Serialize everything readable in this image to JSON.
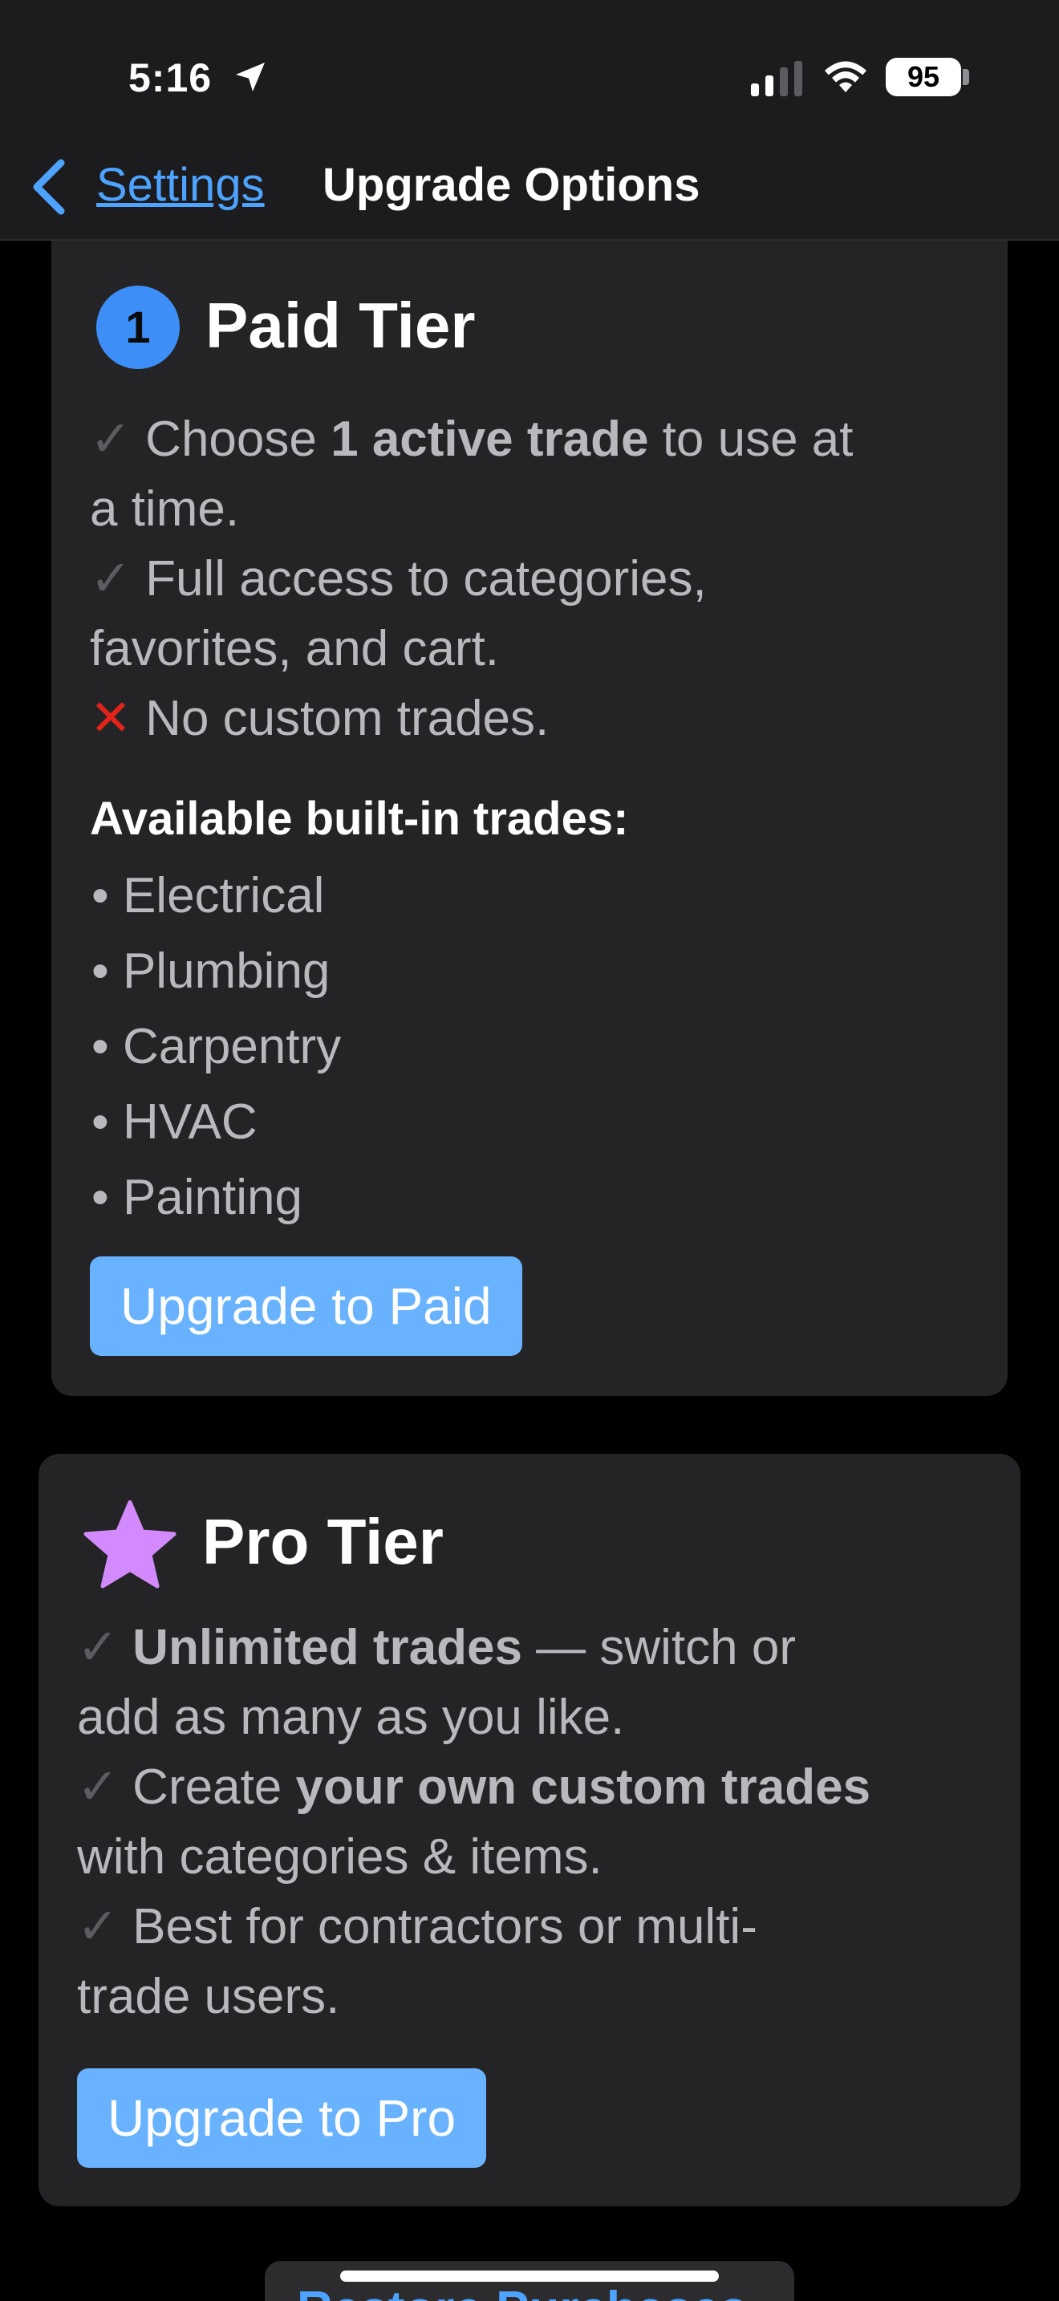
{
  "status_bar": {
    "time": "5:16",
    "battery": "95",
    "icons": [
      "location-arrow-icon",
      "cellular-signal-icon",
      "wifi-icon",
      "battery-icon"
    ]
  },
  "nav": {
    "back_label": "Settings",
    "title": "Upgrade Options",
    "back_icon": "chevron-left-icon"
  },
  "paid": {
    "badge": "1",
    "title": "Paid Tier",
    "lines": [
      {
        "mark": "✓",
        "pre": " Choose ",
        "bold": "1 active trade",
        "post": " to use at",
        "cont": "a time."
      },
      {
        "mark": "✓",
        "text1": " Full access to categories,",
        "text2": "favorites, and cart."
      },
      {
        "mark": "✕",
        "text": " No custom trades."
      }
    ],
    "available_heading": "Available built-in trades:",
    "trades": [
      "Electrical",
      "Plumbing",
      "Carpentry",
      "HVAC",
      "Painting"
    ],
    "button": "Upgrade to Paid"
  },
  "pro": {
    "title": "Pro Tier",
    "icon": "star-icon",
    "lines": [
      {
        "mark": "✓",
        "bold": " Unlimited trades",
        "rest": " — switch or",
        "cont": "add as many as you like."
      },
      {
        "mark": "✓",
        "pre": " Create ",
        "bold": "your own custom trades",
        "cont": "with categories & items."
      },
      {
        "mark": "✓",
        "text1": " Best for contractors or multi-",
        "text2": "trade users."
      }
    ],
    "button": "Upgrade to Pro"
  },
  "bottom": {
    "partial_button": "Restore Purchases"
  },
  "colors": {
    "accent": "#4da3ff",
    "button": "#68b2ff",
    "badge": "#3d8ff7",
    "star": "#d48aff",
    "cross": "#e0241b"
  }
}
